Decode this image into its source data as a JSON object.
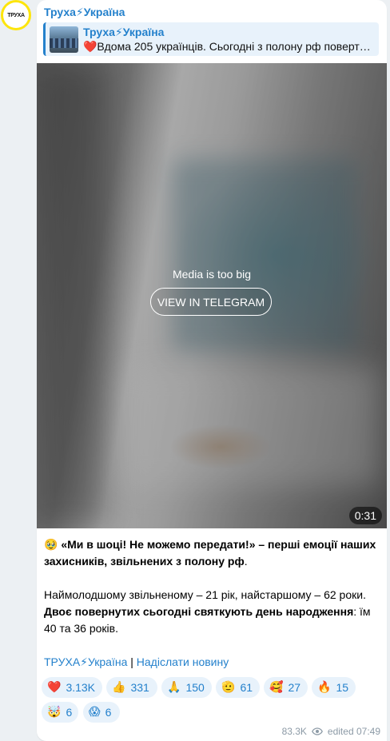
{
  "channel": {
    "name": "Труха⚡Україна",
    "avatar_text": "ТРУХА"
  },
  "reply": {
    "name": "Труха⚡Україна",
    "text": "❤️Вдома 205 українців. Сьогодні з полону рф поверт…"
  },
  "media": {
    "message": "Media is too big",
    "button": "VIEW IN TELEGRAM",
    "duration": "0:31"
  },
  "post": {
    "p1_emoji": "🥹",
    "p1_bold": "«Ми в шоці! Не можемо передати!» – перші емоції наших захисників, звільнених з полону рф",
    "p1_end": ".",
    "p2": "Наймолодшому звільненому – 21 рік, найстаршому – 62 роки.",
    "p3_bold": "Двоє повернутих сьогодні святкують день народження",
    "p3_end": ": їм 40 та 36 років.",
    "link1": "ТРУХА⚡Україна",
    "separator": "|",
    "link2": "Надіслати новину"
  },
  "reactions": [
    {
      "emoji": "❤️",
      "count": "3.13K"
    },
    {
      "emoji": "👍",
      "count": "331"
    },
    {
      "emoji": "🙏",
      "count": "150"
    },
    {
      "emoji": "🫡",
      "count": "61"
    },
    {
      "emoji": "🥰",
      "count": "27"
    },
    {
      "emoji": "🔥",
      "count": "15"
    },
    {
      "emoji": "🤯",
      "count": "6"
    },
    {
      "emoji": "😱",
      "count": "6"
    }
  ],
  "meta": {
    "views": "83.3K",
    "edited": "edited",
    "time": "07:49"
  }
}
